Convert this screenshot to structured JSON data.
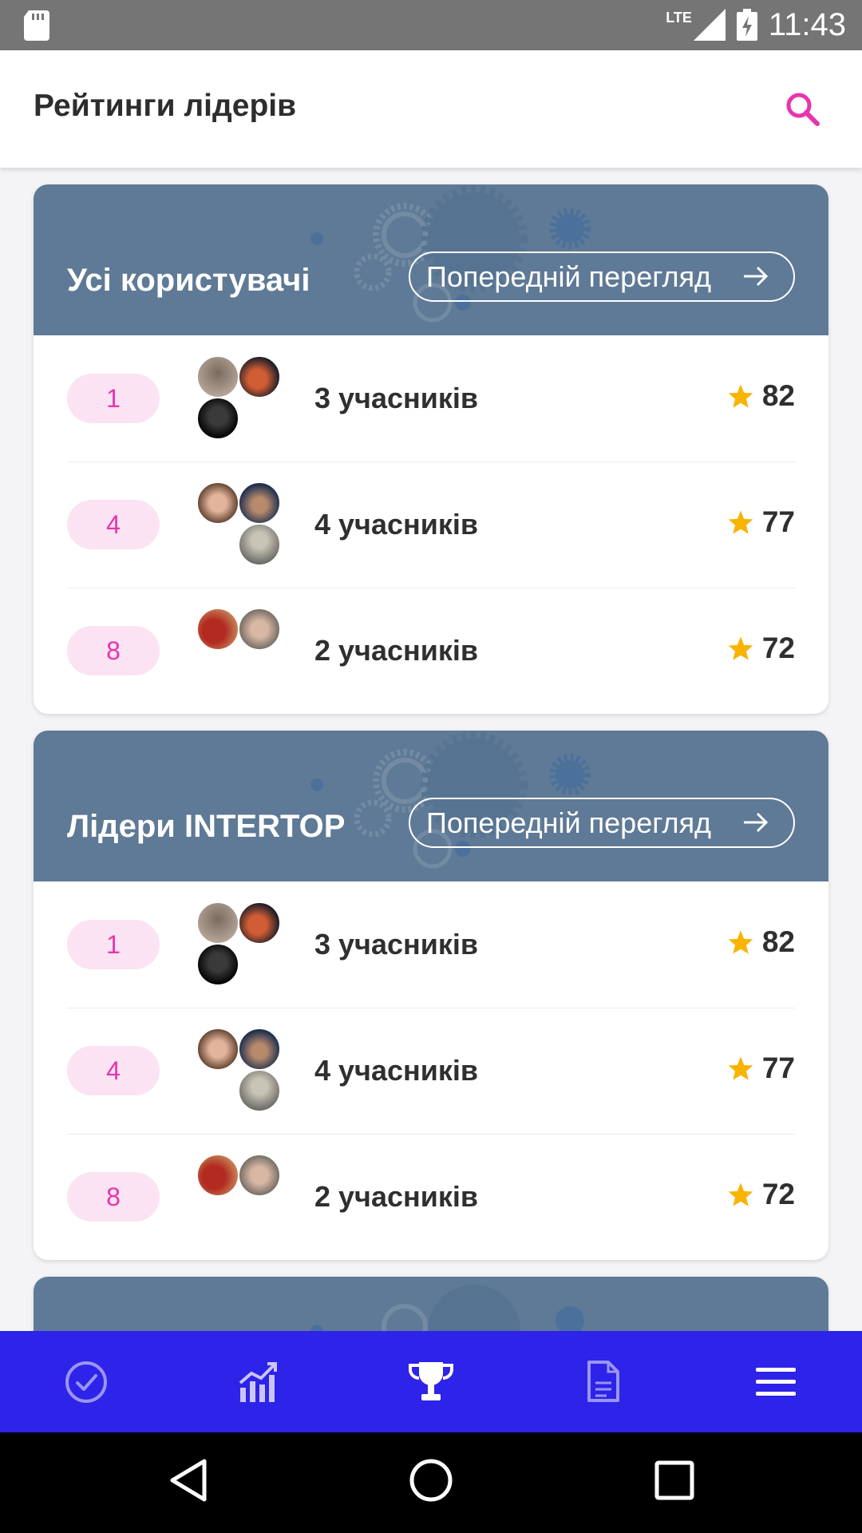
{
  "status_bar": {
    "network": "LTE",
    "time": "11:43"
  },
  "header": {
    "title": "Рейтинги лідерів"
  },
  "cards": [
    {
      "title": "Усі користувачі",
      "preview_label": "Попередній перегляд",
      "rows": [
        {
          "rank": "1",
          "members": "3 учасників",
          "score": "82"
        },
        {
          "rank": "4",
          "members": "4 учасників",
          "score": "77"
        },
        {
          "rank": "8",
          "members": "2 учасників",
          "score": "72"
        }
      ]
    },
    {
      "title": "Лідери INTERTOP",
      "preview_label": "Попередній перегляд",
      "rows": [
        {
          "rank": "1",
          "members": "3 учасників",
          "score": "82"
        },
        {
          "rank": "4",
          "members": "4 учасників",
          "score": "77"
        },
        {
          "rank": "8",
          "members": "2 учасників",
          "score": "72"
        }
      ]
    }
  ],
  "bottom_nav": [
    {
      "icon": "check-circle-icon"
    },
    {
      "icon": "growth-chart-icon"
    },
    {
      "icon": "trophy-icon"
    },
    {
      "icon": "document-icon"
    },
    {
      "icon": "menu-icon"
    }
  ],
  "colors": {
    "accent": "#e735ad",
    "card_header": "#5f7a96",
    "bottom_nav": "#2e23e8",
    "star": "#f8b400"
  }
}
